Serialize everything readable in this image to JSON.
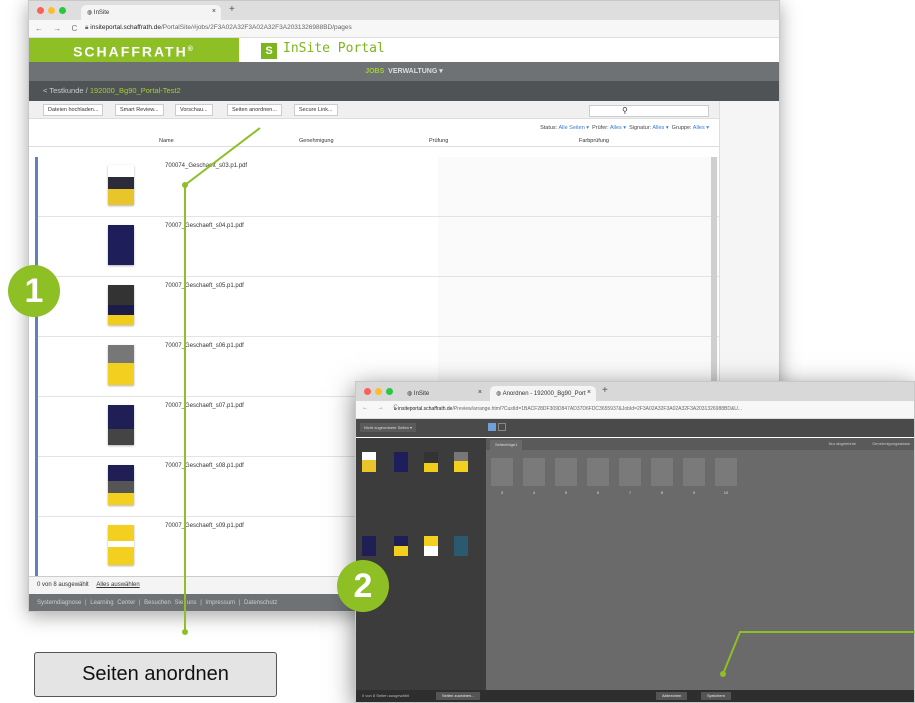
{
  "colors": {
    "brand_green": "#8ebf24",
    "nav_dark": "#6e7274",
    "selection_blue": "#5c86b8",
    "link_blue": "#3a7bd5"
  },
  "window1": {
    "tab_title": "InSite",
    "tab_close": "×",
    "new_tab": "+",
    "url_host": "insiteportal.schaffrath.de",
    "url_path": "/PortalSite/#jobs/2F3A02A32F3A02A32F3A2031326988BD/pages",
    "brand": "SCHAFFRATH",
    "brand_reg": "®",
    "portal_letter": "S",
    "portal_name": "InSite Portal",
    "nav": {
      "jobs": "JOBS",
      "admin": "VERWALTUNG ▾"
    },
    "breadcrumb": {
      "back": "<",
      "customer": "Testkunde",
      "sep": "/",
      "current": "192000_Bg90_Portal-Test2"
    },
    "toolbar": [
      "Dateien hochladen...",
      "Smart Review...",
      "Vorschau...",
      "Seiten anordnen...",
      "Secure Link..."
    ],
    "filters": {
      "status_label": "Status:",
      "status_value": "Alle Seiten ▾",
      "pruefer_label": "Prüfer:",
      "pruefer_value": "Alles ▾",
      "signatur_label": "Signatur:",
      "signatur_value": "Alles ▾",
      "gruppe_label": "Gruppe:",
      "gruppe_value": "Alles ▾"
    },
    "columns": [
      "Name",
      "Genehmigung",
      "Prüfung",
      "Farbprüfung"
    ],
    "files": [
      "700074_Geschaeft_s03.p1.pdf",
      "70007_Geschaeft_s04.p1.pdf",
      "70007_Geschaeft_s05.p1.pdf",
      "70007_Geschaeft_s06.p1.pdf",
      "70007_Geschaeft_s07.p1.pdf",
      "70007_Geschaeft_s08.p1.pdf",
      "70007_Geschaeft_s09.p1.pdf"
    ],
    "selection": {
      "count": "0 von 8 ausgewählt",
      "select_all": "Alles auswählen"
    },
    "footer": "Systemdiagnose  |  Learning Center  |  Besuchen Sie uns  |  Impressum  |  Datenschutz"
  },
  "badges": {
    "one": "1",
    "two": "2"
  },
  "callout": "Seiten anordnen",
  "window2": {
    "tab1": "InSite",
    "tab2": "Anordnen - 192000_Bg90_Port",
    "url_host": "insiteportal.schaffrath.de",
    "url_path": "/Preview/arrange.html?CustId=1BACF28DF309D847AD37D6FDC3655937&JobId=2F3A02A32F3A02A32F3A2031326988BD&U...",
    "left_dropdown": "Nicht zugeordnete Seiten ▾",
    "sheet_tab": "Seitenfolge1",
    "options": [
      "Nur abgelehnte",
      "Genehmigungsstatus"
    ],
    "slots": [
      "3",
      "4",
      "5",
      "6",
      "7",
      "8",
      "9",
      "10"
    ],
    "footer_text": "0 von 8 Seiten ausgewählt",
    "footer_left_btn": "Seiten zuordnen...",
    "cancel": "Abbrechen",
    "save": "Speichern"
  }
}
